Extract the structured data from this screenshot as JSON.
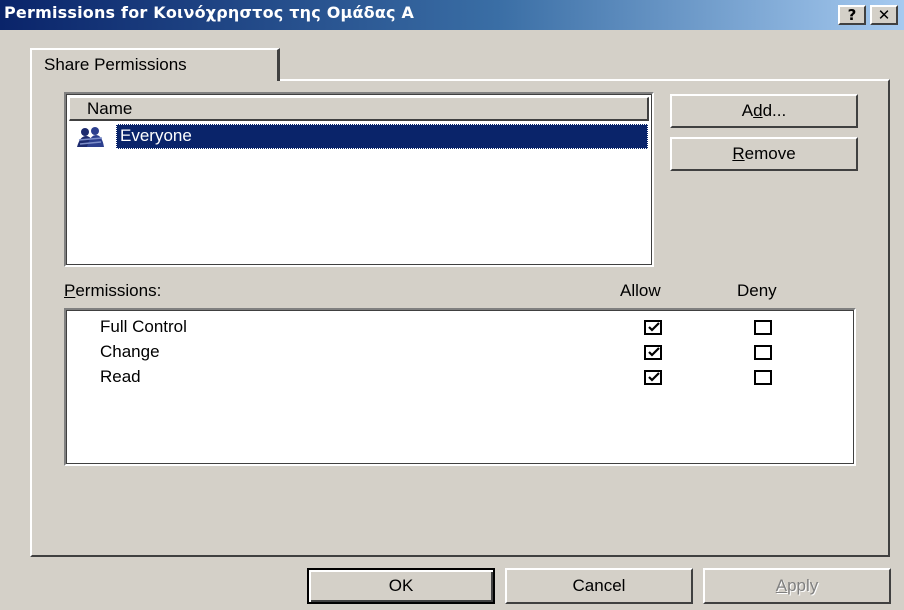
{
  "window": {
    "title": "Permissions for Κοινόχρηστος της Ομάδας Α",
    "help_label": "?",
    "close_label": "✕"
  },
  "tabs": [
    {
      "label": "Share Permissions",
      "active": true
    }
  ],
  "users": {
    "header": "Name",
    "items": [
      {
        "name": "Everyone",
        "icon": "group-icon",
        "selected": true
      }
    ]
  },
  "buttons": {
    "add": {
      "pre": "A",
      "accel": "d",
      "post": "d..."
    },
    "remove": {
      "pre": "",
      "accel": "R",
      "post": "emove"
    },
    "ok": "OK",
    "cancel": "Cancel",
    "apply": {
      "pre": "",
      "accel": "A",
      "post": "pply",
      "disabled": true
    }
  },
  "permissions": {
    "label_accel": "P",
    "label_rest": "ermissions:",
    "allow_header": "Allow",
    "deny_header": "Deny",
    "rows": [
      {
        "name": "Full Control",
        "allow": true,
        "deny": false
      },
      {
        "name": "Change",
        "allow": true,
        "deny": false
      },
      {
        "name": "Read",
        "allow": true,
        "deny": false
      }
    ]
  },
  "colors": {
    "titlebar_start": "#0a246a",
    "titlebar_end": "#a6caf0",
    "selection": "#0a246a",
    "face": "#d4d0c8"
  }
}
